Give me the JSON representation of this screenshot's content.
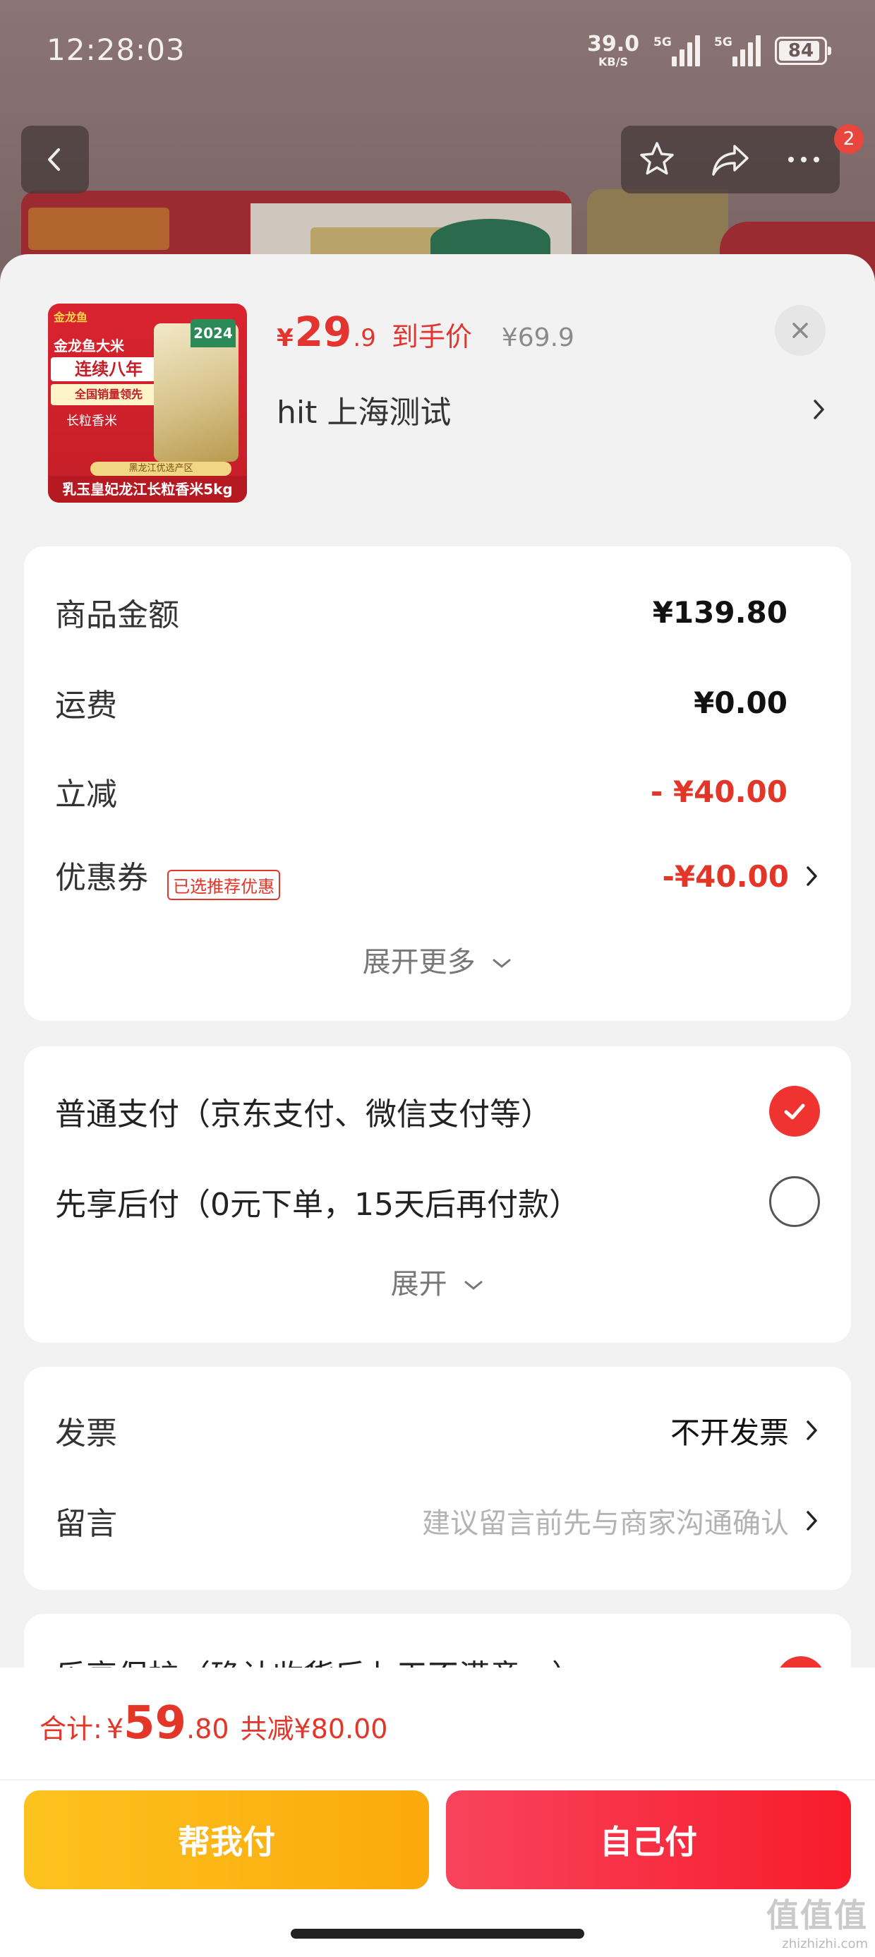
{
  "status_bar": {
    "time": "12:28:03",
    "net_speed_value": "39.0",
    "net_speed_unit": "KB/S",
    "signal1_tag": "5G",
    "signal2_tag": "5G",
    "battery": "84"
  },
  "nav": {
    "back_icon": "chevron-left-icon",
    "star_icon": "star-icon",
    "share_icon": "share-icon",
    "more_icon": "more-dots-icon",
    "badge_count": "2"
  },
  "product": {
    "thumb_brand": "金龙鱼",
    "thumb_line1": "金龙鱼大米",
    "thumb_line2": "连续八年",
    "thumb_line3": "全国销量领先",
    "thumb_line4": "长粒香米",
    "thumb_year": "2024",
    "thumb_origin": "黑龙江优选产区",
    "thumb_caption": "乳玉皇妃龙江长粒香米5kg",
    "price_symbol": "¥",
    "price_int": "29",
    "price_dec": ".9",
    "price_tag": "到手价",
    "price_old": "¥69.9",
    "address": "hit  上海测试"
  },
  "summary": {
    "goods_label": "商品金额",
    "goods_value": "¥139.80",
    "shipping_label": "运费",
    "shipping_value": "¥0.00",
    "discount_label": "立减",
    "discount_value": "- ¥40.00",
    "coupon_label": "优惠券",
    "coupon_chip": "已选推荐优惠",
    "coupon_value": "-¥40.00",
    "expand_more": "展开更多"
  },
  "payment": {
    "option1": "普通支付（京东支付、微信支付等）",
    "option1_selected": true,
    "option2": "先享后付（0元下单，15天后再付款）",
    "option2_selected": false,
    "expand": "展开"
  },
  "extras": {
    "invoice_label": "发票",
    "invoice_value": "不开发票",
    "message_label": "留言",
    "message_placeholder": "建议留言前先与商家沟通确认"
  },
  "partial_row": {
    "label": "乐享保护（确认收货后七天不满意…）"
  },
  "footer": {
    "total_label": "合计:",
    "total_symbol": "¥",
    "total_int": "59",
    "total_dec": ".80",
    "total_save": "共减¥80.00",
    "help_pay_label": "帮我付",
    "self_pay_label": "自己付",
    "watermark_main": "值值值",
    "watermark_sub": "zhizhizhi.com"
  },
  "colors": {
    "accent_red": "#e33629",
    "pay_yellow": "#fdc21f",
    "pay_red": "#f71c2c"
  }
}
